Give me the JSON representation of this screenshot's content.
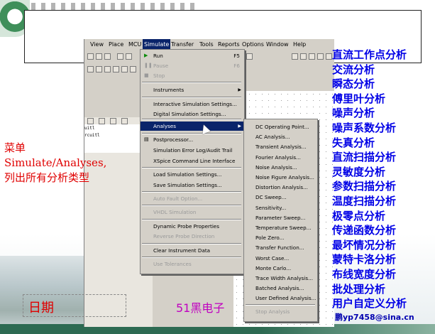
{
  "app": {
    "menubar": [
      "View",
      "Place",
      "MCU",
      "Simulate",
      "Transfer",
      "Tools",
      "Reports",
      "Options",
      "Window",
      "Help"
    ],
    "active_menu": "Simulate",
    "design_lines": [
      "uitl",
      "rcuitl"
    ]
  },
  "simulate_menu": {
    "items": [
      {
        "label": "Run",
        "shortcut": "F5",
        "disabled": false
      },
      {
        "label": "Pause",
        "shortcut": "F6",
        "disabled": true
      },
      {
        "label": "Stop",
        "shortcut": "",
        "disabled": true
      },
      {
        "label": "Instruments",
        "shortcut": "",
        "disabled": false,
        "submenu": true
      },
      {
        "label": "Interactive Simulation Settings...",
        "shortcut": "",
        "disabled": false
      },
      {
        "label": "Digital Simulation Settings...",
        "shortcut": "",
        "disabled": false
      },
      {
        "label": "Analyses",
        "shortcut": "",
        "disabled": false,
        "submenu": true,
        "highlighted": true
      },
      {
        "label": "Postprocessor...",
        "shortcut": "",
        "disabled": false
      },
      {
        "label": "Simulation Error Log/Audit Trail",
        "shortcut": "",
        "disabled": false
      },
      {
        "label": "XSpice Command Line Interface",
        "shortcut": "",
        "disabled": false
      },
      {
        "label": "Load Simulation Settings...",
        "shortcut": "",
        "disabled": false
      },
      {
        "label": "Save Simulation Settings...",
        "shortcut": "",
        "disabled": false
      },
      {
        "label": "Auto Fault Option...",
        "shortcut": "",
        "disabled": true
      },
      {
        "label": "VHDL Simulation",
        "shortcut": "",
        "disabled": true
      },
      {
        "label": "Dynamic Probe Properties",
        "shortcut": "",
        "disabled": false
      },
      {
        "label": "Reverse Probe Direction",
        "shortcut": "",
        "disabled": true
      },
      {
        "label": "Clear Instrument Data",
        "shortcut": "",
        "disabled": false
      },
      {
        "label": "Use Tolerances",
        "shortcut": "",
        "disabled": true
      }
    ]
  },
  "analyses_menu": {
    "items": [
      {
        "label": "DC Operating Point...",
        "disabled": false
      },
      {
        "label": "AC Analysis...",
        "disabled": false
      },
      {
        "label": "Transient Analysis...",
        "disabled": false
      },
      {
        "label": "Fourier Analysis...",
        "disabled": false
      },
      {
        "label": "Noise Analysis...",
        "disabled": false
      },
      {
        "label": "Noise Figure Analysis...",
        "disabled": false
      },
      {
        "label": "Distortion Analysis...",
        "disabled": false
      },
      {
        "label": "DC Sweep...",
        "disabled": false
      },
      {
        "label": "Sensitivity...",
        "disabled": false
      },
      {
        "label": "Parameter Sweep...",
        "disabled": false
      },
      {
        "label": "Temperature Sweep...",
        "disabled": false
      },
      {
        "label": "Pole Zero...",
        "disabled": false
      },
      {
        "label": "Transfer Function...",
        "disabled": false
      },
      {
        "label": "Worst Case...",
        "disabled": false
      },
      {
        "label": "Monte Carlo...",
        "disabled": false
      },
      {
        "label": "Trace Width Analysis...",
        "disabled": false
      },
      {
        "label": "Batched Analysis...",
        "disabled": false
      },
      {
        "label": "User Defined Analysis...",
        "disabled": false
      },
      {
        "label": "Stop Analysis",
        "disabled": true
      }
    ]
  },
  "analysis_types_zh": [
    "直流工作点分析",
    "交流分析",
    "瞬态分析",
    "傅里叶分析",
    "噪声分析",
    "噪声系数分析",
    "失真分析",
    "直流扫描分析",
    "灵敏度分析",
    "参数扫描分析",
    "温度扫描分析",
    "极零点分析",
    "传递函数分析",
    "最坏情况分析",
    "蒙特卡洛分析",
    "布线宽度分析",
    "批处理分析",
    "用户自定义分析"
  ],
  "note": {
    "line1": "菜单",
    "line2": "Simulate/Analyses,",
    "line3": "列出所有分析类型"
  },
  "footer": {
    "date": "日期",
    "brand": "51黑电子",
    "email": "鹏yp7458@sina.cn"
  },
  "colors": {
    "highlight": "#0a246a",
    "list": "#0000e6",
    "note": "#e00000"
  }
}
